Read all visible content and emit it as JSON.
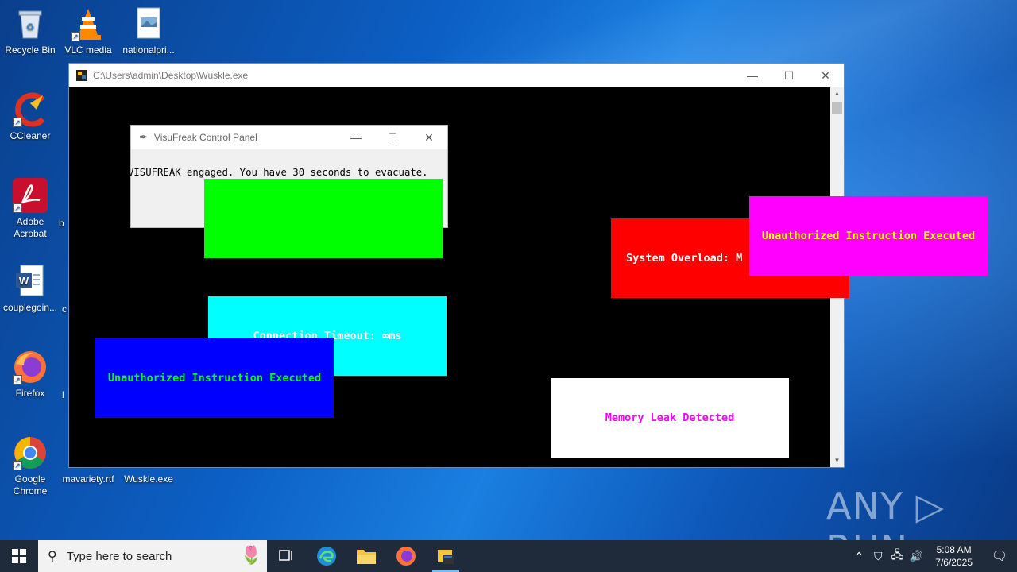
{
  "desktop": {
    "icons": [
      {
        "label": "Recycle Bin"
      },
      {
        "label": "VLC media"
      },
      {
        "label": "nationalpri..."
      },
      {
        "label": "CCleaner"
      },
      {
        "label": "Adobe Acrobat"
      },
      {
        "label": "b"
      },
      {
        "label": "couplegoin..."
      },
      {
        "label": "c"
      },
      {
        "label": "Firefox"
      },
      {
        "label": "l"
      },
      {
        "label": "Google Chrome"
      },
      {
        "label": "mavariety.rtf"
      },
      {
        "label": "Wuskle.exe"
      }
    ]
  },
  "console_window": {
    "title": "C:\\Users\\admin\\Desktop\\Wuskle.exe",
    "minimize": "—",
    "maximize": "☐",
    "close": "✕"
  },
  "control_panel": {
    "title": "VisuFreak Control Panel",
    "message": "VISUFREAK engaged. You have 30 seconds to evacuate.",
    "minimize": "—",
    "maximize": "☐",
    "close": "✕"
  },
  "popups": [
    {
      "id": "green-box",
      "text": "",
      "bg": "#00ff00",
      "fg": "#00ff00"
    },
    {
      "id": "cyan-box",
      "text": "Connection Timeout: ∞ms",
      "bg": "#00ffff",
      "fg": "#ffffff"
    },
    {
      "id": "blue-box",
      "text": "Unauthorized Instruction Executed",
      "bg": "#0000ff",
      "fg": "#00ff00"
    },
    {
      "id": "red-box",
      "text": "System Overload: M",
      "bg": "#ff0000",
      "fg": "#ffffff"
    },
    {
      "id": "magenta-box",
      "text": "Unauthorized Instruction Executed",
      "bg": "#ff00ff",
      "fg": "#ffff00"
    },
    {
      "id": "white-box",
      "text": "Memory Leak Detected",
      "bg": "#ffffff",
      "fg": "#ff00ff"
    }
  ],
  "watermark": "ANY ▷ RUN",
  "taskbar": {
    "search_placeholder": "Type here to search",
    "time": "5:08 AM",
    "date": "7/6/2025"
  }
}
